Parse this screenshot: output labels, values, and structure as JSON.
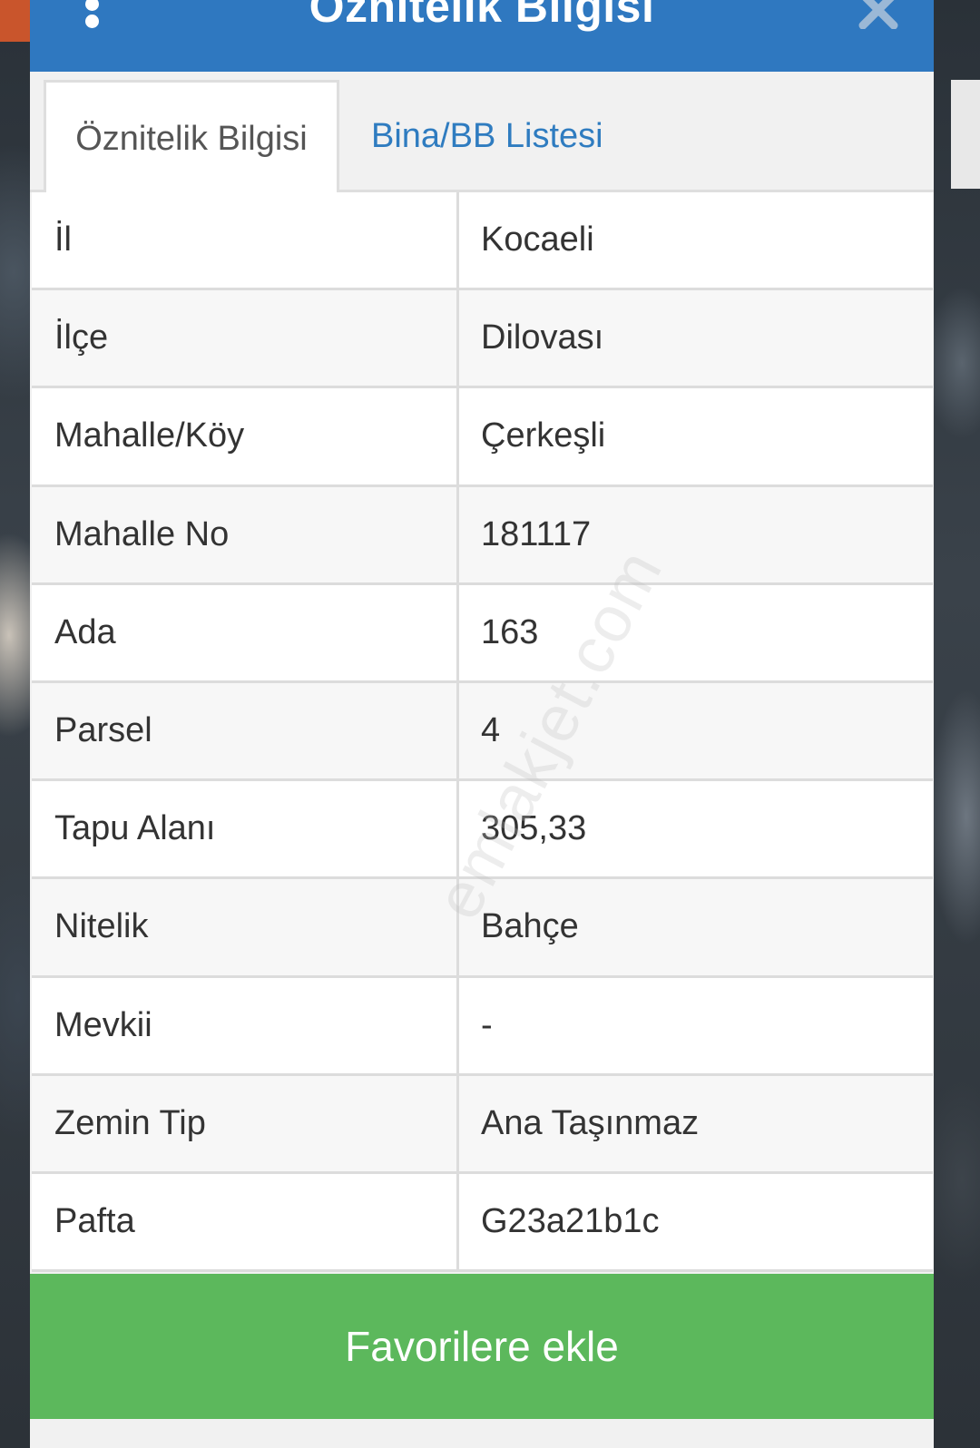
{
  "dialog": {
    "title": "Öznitelik Bilgisi"
  },
  "tabs": [
    {
      "label": "Öznitelik Bilgisi",
      "active": true
    },
    {
      "label": "Bina/BB Listesi",
      "active": false
    }
  ],
  "rows": [
    {
      "key": "İl",
      "value": "Kocaeli"
    },
    {
      "key": "İlçe",
      "value": "Dilovası"
    },
    {
      "key": "Mahalle/Köy",
      "value": "Çerkeşli"
    },
    {
      "key": "Mahalle No",
      "value": "181117"
    },
    {
      "key": "Ada",
      "value": "163"
    },
    {
      "key": "Parsel",
      "value": "4"
    },
    {
      "key": "Tapu Alanı",
      "value": "305,33"
    },
    {
      "key": "Nitelik",
      "value": "Bahçe"
    },
    {
      "key": "Mevkii",
      "value": "-"
    },
    {
      "key": "Zemin Tip",
      "value": "Ana Taşınmaz"
    },
    {
      "key": "Pafta",
      "value": "G23a21b1c"
    }
  ],
  "watermark": "emlakjet.com",
  "actions": {
    "favorite_label": "Favorilere ekle"
  },
  "colors": {
    "header": "#2f78c0",
    "tab_link": "#2f7cc0",
    "button": "#5cb85c"
  },
  "icons": {
    "menu": "more-vertical-icon",
    "close": "close-icon"
  }
}
